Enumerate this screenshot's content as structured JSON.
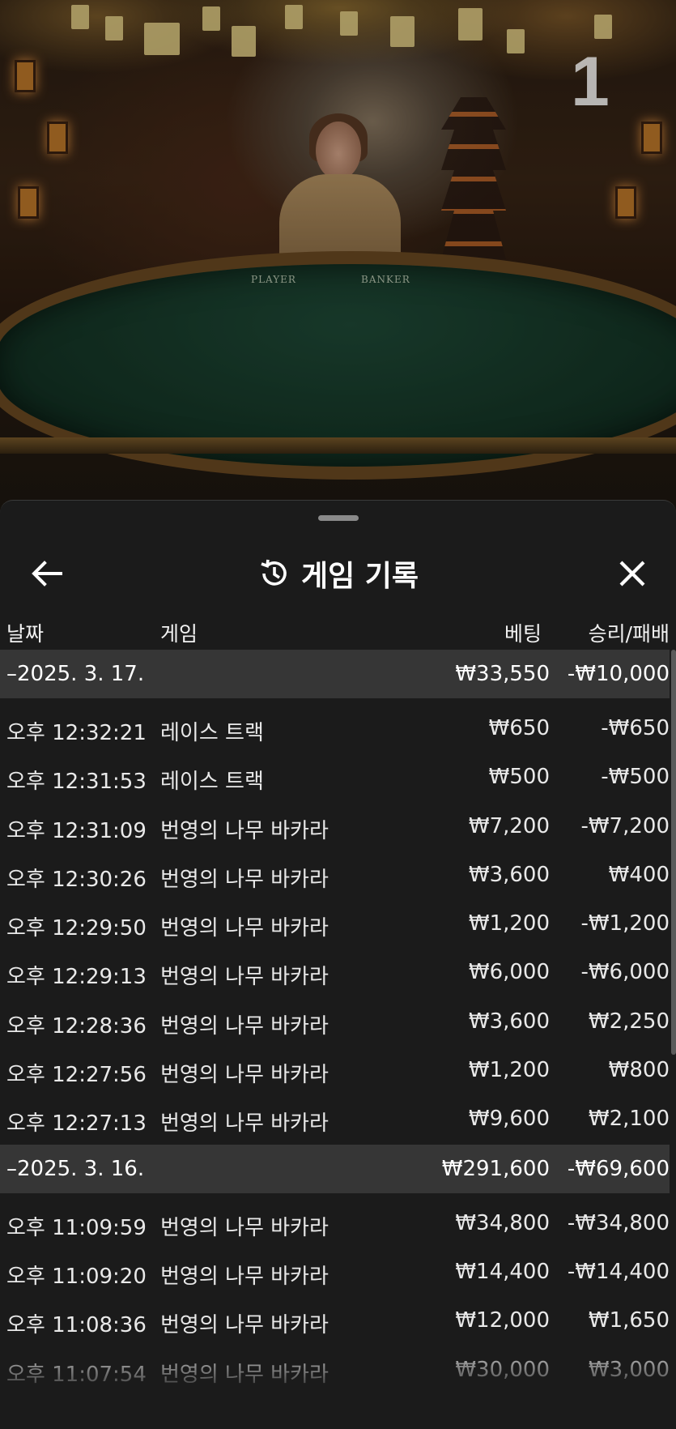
{
  "scene": {
    "round_number": "1",
    "table_labels": {
      "player": "PLAYER",
      "banker": "BANKER"
    }
  },
  "panel": {
    "title": "게임 기록",
    "back_icon": "arrow-left-icon",
    "history_icon": "history-icon",
    "close_icon": "close-icon"
  },
  "columns": {
    "date": "날짜",
    "game": "게임",
    "bet": "베팅",
    "result": "승리/패배"
  },
  "groups": [
    {
      "date": "–2025. 3. 17.",
      "bet_total": "₩33,550",
      "result_total": "-₩10,000",
      "rows": [
        {
          "time": "오후 12:32:21",
          "game": "레이스 트랙",
          "bet": "₩650",
          "result": "-₩650"
        },
        {
          "time": "오후 12:31:53",
          "game": "레이스 트랙",
          "bet": "₩500",
          "result": "-₩500"
        },
        {
          "time": "오후 12:31:09",
          "game": "번영의 나무 바카라",
          "bet": "₩7,200",
          "result": "-₩7,200"
        },
        {
          "time": "오후 12:30:26",
          "game": "번영의 나무 바카라",
          "bet": "₩3,600",
          "result": "₩400"
        },
        {
          "time": "오후 12:29:50",
          "game": "번영의 나무 바카라",
          "bet": "₩1,200",
          "result": "-₩1,200"
        },
        {
          "time": "오후 12:29:13",
          "game": "번영의 나무 바카라",
          "bet": "₩6,000",
          "result": "-₩6,000"
        },
        {
          "time": "오후 12:28:36",
          "game": "번영의 나무 바카라",
          "bet": "₩3,600",
          "result": "₩2,250"
        },
        {
          "time": "오후 12:27:56",
          "game": "번영의 나무 바카라",
          "bet": "₩1,200",
          "result": "₩800"
        },
        {
          "time": "오후 12:27:13",
          "game": "번영의 나무 바카라",
          "bet": "₩9,600",
          "result": "₩2,100"
        }
      ]
    },
    {
      "date": "–2025. 3. 16.",
      "bet_total": "₩291,600",
      "result_total": "-₩69,600",
      "rows": [
        {
          "time": "오후 11:09:59",
          "game": "번영의 나무 바카라",
          "bet": "₩34,800",
          "result": "-₩34,800"
        },
        {
          "time": "오후 11:09:20",
          "game": "번영의 나무 바카라",
          "bet": "₩14,400",
          "result": "-₩14,400"
        },
        {
          "time": "오후 11:08:36",
          "game": "번영의 나무 바카라",
          "bet": "₩12,000",
          "result": "₩1,650"
        },
        {
          "time": "오후 11:07:54",
          "game": "번영의 나무 바카라",
          "bet": "₩30,000",
          "result": "₩3,000"
        }
      ]
    }
  ]
}
